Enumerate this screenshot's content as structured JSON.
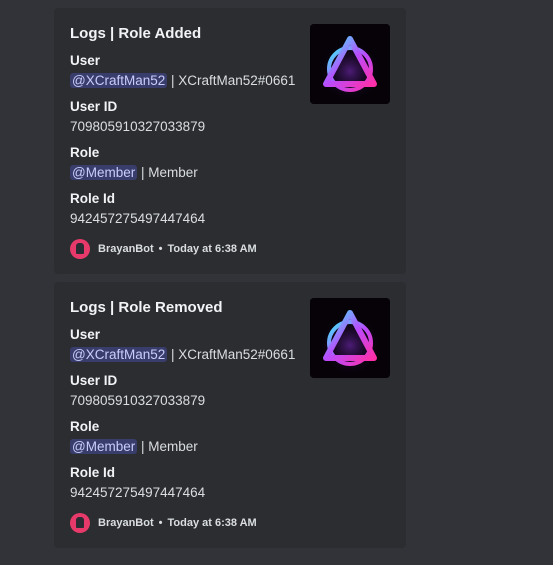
{
  "embeds": [
    {
      "title": "Logs | Role Added",
      "fields": {
        "user_name": "User",
        "user_mention": "@XCraftMan52",
        "user_sep": " | ",
        "user_tag": "XCraftMan52#0661",
        "userid_name": "User ID",
        "userid_value": "709805910327033879",
        "role_name": "Role",
        "role_mention": "@Member",
        "role_sep": " | ",
        "role_plain": "Member",
        "roleid_name": "Role Id",
        "roleid_value": "942457275497447464"
      },
      "footer": {
        "author": "BrayanBot",
        "dot": "•",
        "time": "Today at 6:38 AM"
      },
      "thumbnail_icon": "neon-triangle-logo"
    },
    {
      "title": "Logs | Role Removed",
      "fields": {
        "user_name": "User",
        "user_mention": "@XCraftMan52",
        "user_sep": " | ",
        "user_tag": "XCraftMan52#0661",
        "userid_name": "User ID",
        "userid_value": "709805910327033879",
        "role_name": "Role",
        "role_mention": "@Member",
        "role_sep": " | ",
        "role_plain": "Member",
        "roleid_name": "Role Id",
        "roleid_value": "942457275497447464"
      },
      "footer": {
        "author": "BrayanBot",
        "dot": "•",
        "time": "Today at 6:38 AM"
      },
      "thumbnail_icon": "neon-triangle-logo"
    }
  ],
  "colors": {
    "background": "#313338",
    "embed_background": "#2b2d31",
    "mention_text": "#c9cdfb",
    "avatar": "#e83a6a"
  }
}
